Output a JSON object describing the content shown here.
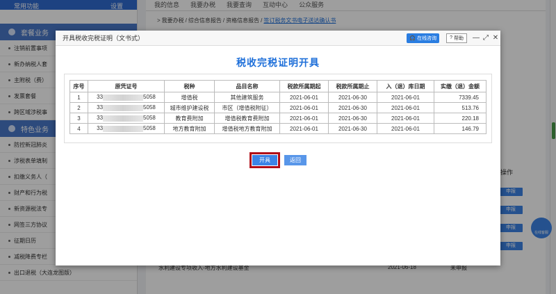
{
  "background": {
    "sidebar_top_left": "常用功能",
    "sidebar_top_right": "设置",
    "sections": [
      {
        "title": "套餐业务",
        "items": [
          "注销前置事项",
          "新办纳税人套",
          "主附税（费）",
          "发票套餐",
          "跨区域涉税事"
        ]
      },
      {
        "title": "特色业务",
        "items": [
          "防控新冠肺炎",
          "涉税表单填制",
          "扣缴义务人（",
          "财产和行为税",
          "新资源税法专",
          "网签三方协议",
          "征期日历",
          "减税降费专栏",
          "出口退税（大连龙图版）"
        ]
      }
    ],
    "tabs": [
      "我的信息",
      "我要办税",
      "我要查询",
      "互动中心",
      "公众服务"
    ],
    "breadcrumb": [
      "我要办税",
      "综合信息报告",
      "资格信息报告"
    ],
    "breadcrumb_link": "签订税务文书电子送达确认书",
    "column_header": "操作",
    "report_button": "申报",
    "last_row": {
      "name": "水利建设专项收入-地方水利建设基金",
      "date": "2021-06-18",
      "status": "未申报"
    },
    "float_button": "在线客服"
  },
  "modal": {
    "window_title": "开具税收完税证明（文书式）",
    "consult_label": "在线咨询",
    "help_label": "帮助",
    "heading": "税收完税证明开具",
    "columns": [
      "序号",
      "原凭证号",
      "税种",
      "品目名称",
      "税款所属期起",
      "税款所属期止",
      "入（退）库日期",
      "实缴（退）金额"
    ],
    "rows": [
      {
        "seq": "1",
        "voucher_prefix": "33",
        "voucher_suffix": "5058",
        "tax": "增值税",
        "item": "其他建筑服务",
        "start": "2021-06-01",
        "end": "2021-06-30",
        "date": "2021-06-01",
        "amount": "7339.45"
      },
      {
        "seq": "2",
        "voucher_prefix": "33",
        "voucher_suffix": "5058",
        "tax": "城市维护建设税",
        "item": "市区（增值税附征）",
        "start": "2021-06-01",
        "end": "2021-06-30",
        "date": "2021-06-01",
        "amount": "513.76"
      },
      {
        "seq": "3",
        "voucher_prefix": "33",
        "voucher_suffix": "5058",
        "tax": "教育费附加",
        "item": "增值税教育费附加",
        "start": "2021-06-01",
        "end": "2021-06-30",
        "date": "2021-06-01",
        "amount": "220.18"
      },
      {
        "seq": "4",
        "voucher_prefix": "33",
        "voucher_suffix": "5058",
        "tax": "地方教育附加",
        "item": "增值税地方教育附加",
        "start": "2021-06-01",
        "end": "2021-06-30",
        "date": "2021-06-01",
        "amount": "146.79"
      }
    ],
    "issue_button": "开具",
    "back_button": "返回"
  }
}
